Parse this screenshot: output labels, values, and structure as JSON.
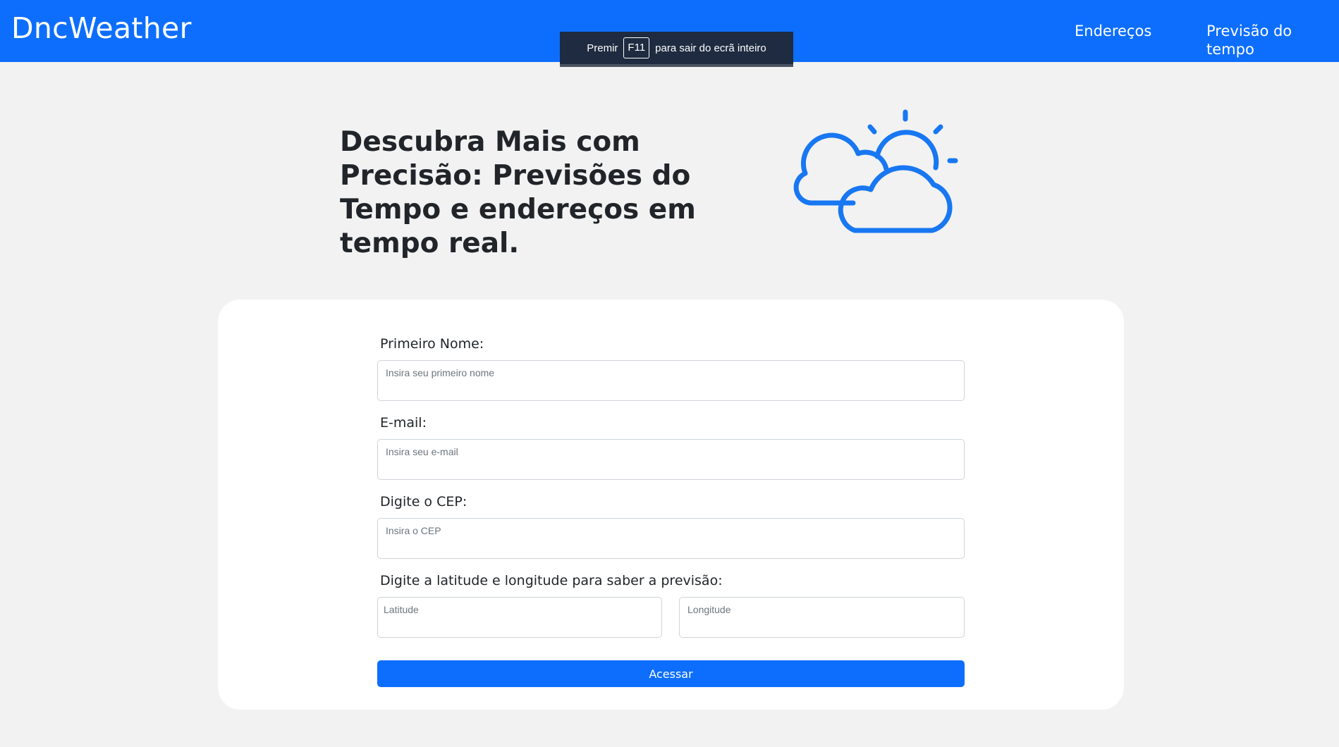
{
  "header": {
    "logo": "DncWeather",
    "nav": [
      {
        "label": "Endereços"
      },
      {
        "label": "Previsão do tempo"
      }
    ],
    "accent_color": "#0d6efd"
  },
  "fullscreen_toast": {
    "before": "Premir",
    "key": "F11",
    "after": "para sair do ecrã inteiro"
  },
  "hero": {
    "title": "Descubra Mais com Precisão: Previsões do Tempo e endereços em tempo real.",
    "icon": "cloudy-sun-icon"
  },
  "form": {
    "first_name": {
      "label": "Primeiro Nome:",
      "placeholder": "Insira seu primeiro nome",
      "value": ""
    },
    "email": {
      "label": "E-mail:",
      "placeholder": "Insira seu e-mail",
      "value": ""
    },
    "cep": {
      "label": "Digite o CEP:",
      "placeholder": "Insira o CEP",
      "value": ""
    },
    "coords": {
      "label": "Digite a latitude e longitude para saber a previsão:",
      "latitude_placeholder": "Latitude",
      "longitude_placeholder": "Longitude"
    },
    "submit_label": "Acessar"
  }
}
